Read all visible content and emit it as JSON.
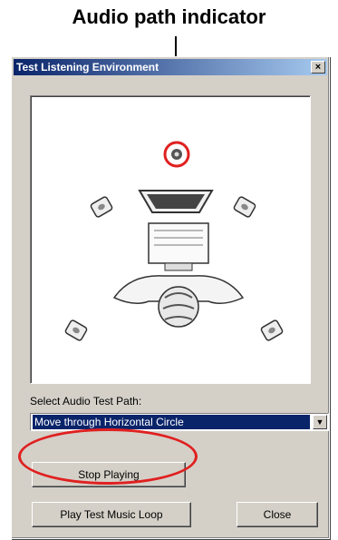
{
  "annotation": {
    "title": "Audio path indicator"
  },
  "window": {
    "title": "Test Listening Environment",
    "close_glyph": "×"
  },
  "audio_path": {
    "label": "Select Audio Test Path:",
    "selected": "Move through Horizontal Circle",
    "dropdown_icon": "triangle-down"
  },
  "buttons": {
    "stop": "Stop Playing",
    "play_loop": "Play Test Music Loop",
    "close": "Close"
  },
  "highlight_color": "#e02020"
}
